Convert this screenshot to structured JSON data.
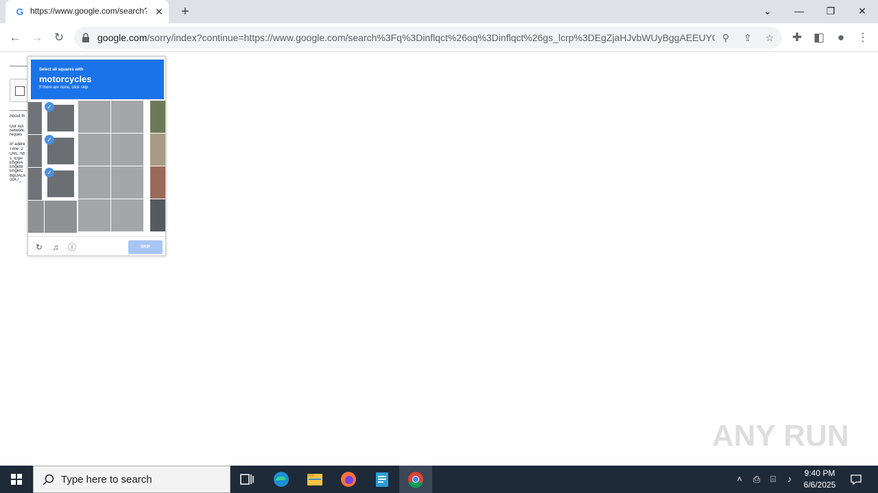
{
  "browser": {
    "tab": {
      "favicon": "G",
      "title": "https://www.google.com/search?"
    },
    "address": {
      "host": "google.com",
      "path": "/sorry/index?continue=https://www.google.com/search%3Fq%3Dinflqct%26oq%3Dinflqct%26gs_lcrp%3DEgZjaHJvbWUyBggAEEUYOT..."
    }
  },
  "page_behind": {
    "lines": [
      "About th",
      "Our sys",
      "network.",
      "reques",
      "IP addre",
      "Time: 2",
      "URL: htt",
      "s_lcrp=",
      "EhgkIA",
      "EhgkIB",
      "EhgkIC",
      "BgOALA",
      "0cK7_"
    ]
  },
  "captcha": {
    "instruction_top": "Select all squares with",
    "target": "motorcycles",
    "instruction_bottom": "If there are none, click skip",
    "skip_label": "SKIP",
    "selected_tiles": [
      [
        0,
        0
      ],
      [
        1,
        0
      ],
      [
        2,
        0
      ]
    ]
  },
  "watermark": {
    "text": "ANY RUN"
  },
  "taskbar": {
    "search_placeholder": "Type here to search",
    "time": "9:40 PM",
    "date": "6/6/2025"
  }
}
